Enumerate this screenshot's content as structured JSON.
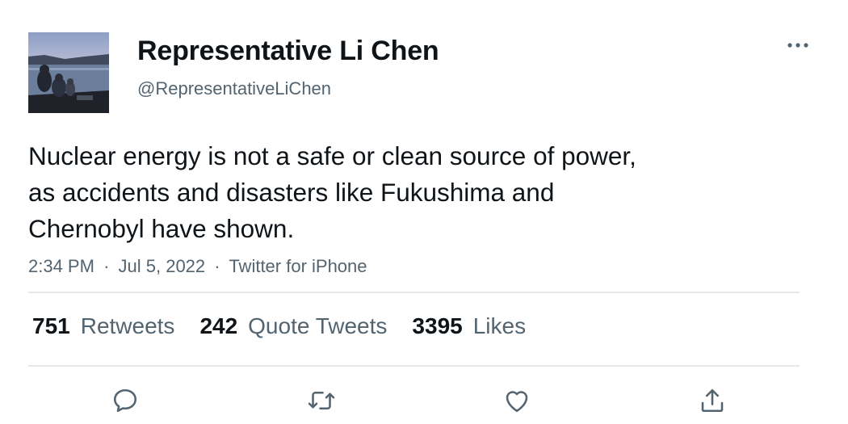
{
  "author": {
    "display_name": "Representative Li Chen",
    "handle": "@RepresentativeLiChen",
    "avatar_icon": "profile-photo-lakeside-family"
  },
  "tweet": {
    "lines": [
      "Nuclear energy is not a safe or clean source of power,",
      "as accidents and disasters like Fukushima and",
      "Chernobyl have shown."
    ],
    "time": "2:34 PM",
    "date": "Jul 5, 2022",
    "source": "Twitter for iPhone",
    "separator": "·"
  },
  "stats": {
    "retweets": {
      "count": "751",
      "label": "Retweets"
    },
    "quotes": {
      "count": "242",
      "label": "Quote Tweets"
    },
    "likes": {
      "count": "3395",
      "label": "Likes"
    }
  },
  "actions": [
    {
      "name": "reply",
      "icon": "reply-icon"
    },
    {
      "name": "retweet",
      "icon": "retweet-icon"
    },
    {
      "name": "like",
      "icon": "heart-icon"
    },
    {
      "name": "share",
      "icon": "share-icon"
    }
  ],
  "colors": {
    "text_primary": "#0f1419",
    "text_secondary": "#536471",
    "divider": "#e4e8eb"
  }
}
